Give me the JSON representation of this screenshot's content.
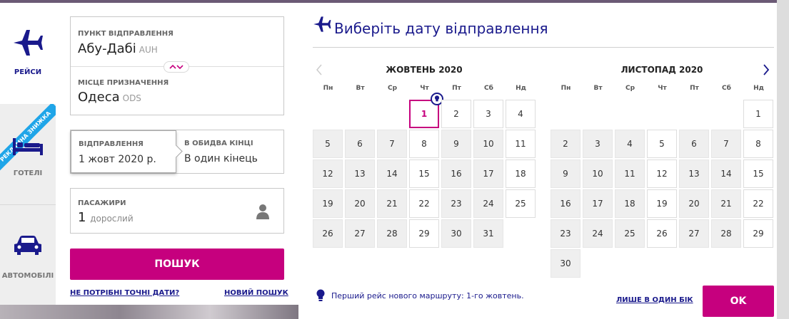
{
  "tabs": [
    {
      "label": "РЕЙСИ",
      "icon": "airplane-icon",
      "active": true
    },
    {
      "label": "ГОТЕЛІ",
      "icon": "bed-icon",
      "active": false,
      "ribbon": "РЕКЛАМНА ЗНИЖКА"
    },
    {
      "label": "АВТОМОБІЛІ",
      "icon": "car-icon",
      "active": false
    }
  ],
  "form": {
    "origin": {
      "label": "ПУНКТ ВІДПРАВЛЕННЯ",
      "city": "Абу-Дабі",
      "code": "AUH"
    },
    "destination": {
      "label": "МІСЦЕ ПРИЗНАЧЕННЯ",
      "city": "Одеса",
      "code": "ODS"
    },
    "departure": {
      "label": "ВІДПРАВЛЕННЯ",
      "value": "1 жовт 2020 р."
    },
    "return": {
      "label": "В ОБИДВА КІНЦІ",
      "value": "В один кінець"
    },
    "passengers": {
      "label": "ПАСАЖИРИ",
      "count": "1",
      "type": "дорослий"
    },
    "search_label": "ПОШУК",
    "flexible_link": "НЕ ПОТРІБНІ ТОЧНІ ДАТИ?",
    "new_search_link": "НОВИЙ ПОШУК"
  },
  "calendar": {
    "title": "Виберіть дату відправлення",
    "weekdays": [
      "Пн",
      "Вт",
      "Ср",
      "Чт",
      "Пт",
      "Сб",
      "Нд"
    ],
    "months": [
      {
        "name": "ЖОВТЕНЬ 2020",
        "first_weekday": 3,
        "days": 31,
        "selected": 1,
        "available": [
          1,
          2,
          3,
          4,
          8,
          11,
          15,
          18,
          22,
          25,
          29
        ]
      },
      {
        "name": "ЛИСТОПАД 2020",
        "first_weekday": 6,
        "days": 30,
        "selected": null,
        "available": [
          1,
          5,
          8,
          12,
          15,
          19,
          22,
          26,
          29
        ]
      }
    ],
    "note": "Перший рейс нового маршруту: 1-го жовтень.",
    "oneway_link": "ЛИШЕ В ОДИН БІК",
    "ok_label": "OK"
  },
  "colors": {
    "accent": "#c6007e",
    "brand": "#1a1a8c"
  }
}
